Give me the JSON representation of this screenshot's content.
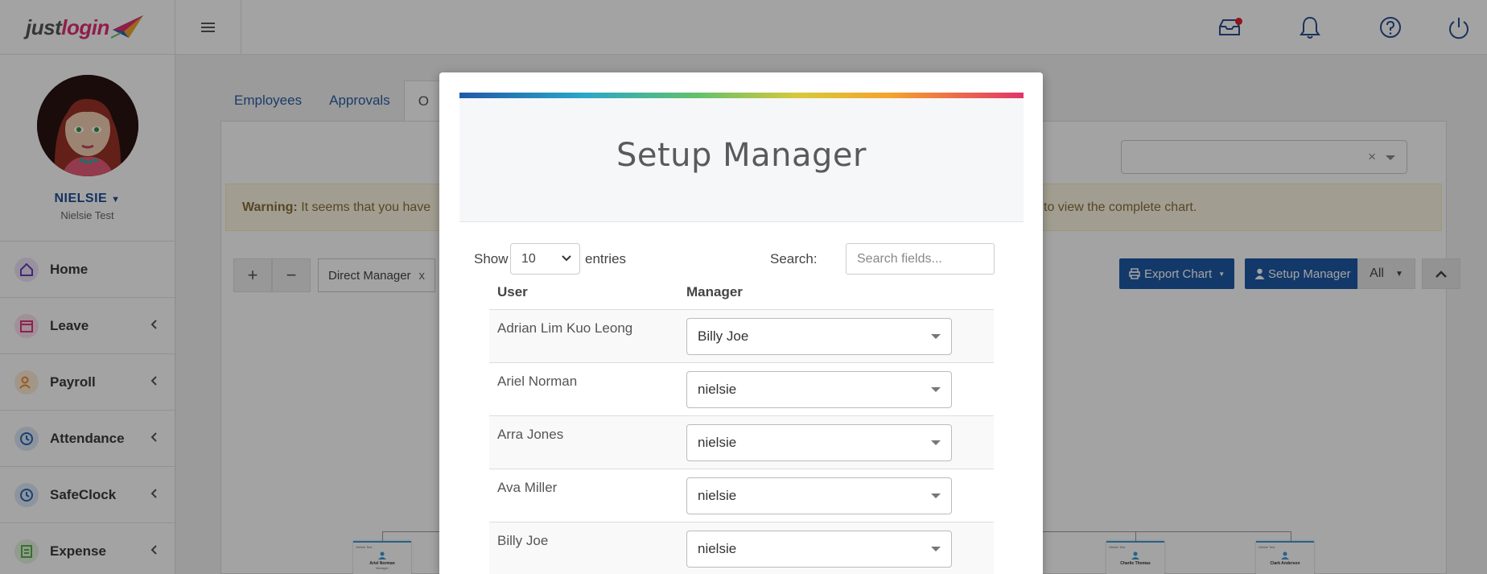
{
  "app": {
    "logo_part1": "just",
    "logo_part2": "login"
  },
  "topbar": {
    "icons": [
      "inbox-icon",
      "bell-icon",
      "help-icon",
      "power-icon"
    ]
  },
  "profile": {
    "name": "NIELSIE",
    "subtitle": "Nielsie Test"
  },
  "sidebar": {
    "items": [
      {
        "label": "Home",
        "icon": "home-icon",
        "color": "#6a3fb5"
      },
      {
        "label": "Leave",
        "icon": "calendar-icon",
        "color": "#e0367a"
      },
      {
        "label": "Payroll",
        "icon": "payroll-icon",
        "color": "#f08c2a"
      },
      {
        "label": "Attendance",
        "icon": "clock-icon",
        "color": "#2a64b0"
      },
      {
        "label": "SafeClock",
        "icon": "clock-icon",
        "color": "#2a64b0"
      },
      {
        "label": "Expense",
        "icon": "receipt-icon",
        "color": "#5ab04a"
      }
    ]
  },
  "tabs": [
    {
      "label": "Employees"
    },
    {
      "label": "Approvals"
    },
    {
      "label": "O"
    }
  ],
  "warning": {
    "strong": "Warning:",
    "text_left": "It seems that you have",
    "text_right": "to view the complete chart."
  },
  "toolbar": {
    "add": "+",
    "remove": "−",
    "chip_label": "Direct Manager",
    "chip_remove": "x",
    "export_label": "Export Chart",
    "setup_label": "Setup Manager",
    "view_label": "All"
  },
  "org": {
    "cards": [
      {
        "caption": "Nielsie Test",
        "name": "Ariel Norman",
        "role": "Manager"
      },
      {
        "caption": "Nielsie Test",
        "name": "Charlie Thomas",
        "role": ""
      },
      {
        "caption": "Nielsie Test",
        "name": "Clark Anderson",
        "role": ""
      }
    ]
  },
  "modal": {
    "title": "Setup Manager",
    "show_label": "Show",
    "length_value": "10",
    "entries_label": "entries",
    "search_label": "Search:",
    "search_placeholder": "Search fields...",
    "columns": [
      "User",
      "Manager"
    ],
    "rows": [
      {
        "user": "Adrian Lim Kuo Leong",
        "manager": "Billy Joe"
      },
      {
        "user": "Ariel Norman",
        "manager": "nielsie"
      },
      {
        "user": "Arra Jones",
        "manager": "nielsie"
      },
      {
        "user": "Ava Miller",
        "manager": "nielsie"
      },
      {
        "user": "Billy Joe",
        "manager": "nielsie"
      }
    ]
  },
  "colors": {
    "brand_blue": "#1f5aa6",
    "brand_pink": "#e22e75"
  }
}
